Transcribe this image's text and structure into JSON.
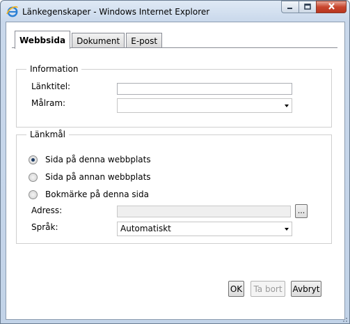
{
  "window": {
    "title": "Länkegenskaper - Windows Internet Explorer",
    "minimize_icon": "minimize-icon",
    "maximize_icon": "maximize-icon",
    "close_icon": "close-icon"
  },
  "tabs": [
    {
      "label": "Webbsida",
      "active": true
    },
    {
      "label": "Dokument",
      "active": false
    },
    {
      "label": "E-post",
      "active": false
    }
  ],
  "information": {
    "legend": "Information",
    "link_title_label": "Länktitel:",
    "link_title_value": "",
    "target_label": "Målram:",
    "target_value": ""
  },
  "link_target": {
    "legend": "Länkmål",
    "options": [
      {
        "label": "Sida på denna webbplats",
        "checked": true
      },
      {
        "label": "Sida på annan webbplats",
        "checked": false
      },
      {
        "label": "Bokmärke på denna sida",
        "checked": false
      }
    ],
    "address_label": "Adress:",
    "address_value": "",
    "browse_label": "...",
    "language_label": "Språk:",
    "language_value": "Automatiskt"
  },
  "buttons": {
    "ok": "OK",
    "delete": "Ta bort",
    "cancel": "Avbryt"
  },
  "colors": {
    "title_bar": "#c9d8eb",
    "close_button": "#c8462e",
    "radio_checked": "#1d3b63"
  }
}
